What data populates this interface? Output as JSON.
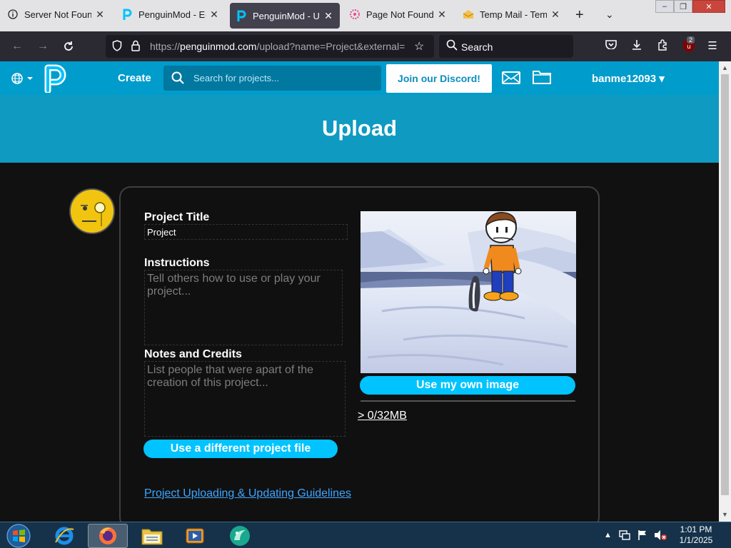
{
  "browser": {
    "tabs": [
      {
        "title": "Server Not Found",
        "icon": "info-icon",
        "active": false
      },
      {
        "title": "PenguinMod - Editor",
        "icon": "penguinmod-icon",
        "active": false
      },
      {
        "title": "PenguinMod - Upload",
        "icon": "penguinmod-icon",
        "active": true
      },
      {
        "title": "Page Not Found - ",
        "icon": "flower-icon",
        "active": false
      },
      {
        "title": "Temp Mail - Temporary",
        "icon": "mail-icon",
        "active": false
      }
    ],
    "url": {
      "prefix": "https://",
      "domain": "penguinmod.com",
      "path": "/upload?name=Project&external="
    },
    "search_label": "Search",
    "extension_badge": "2"
  },
  "site": {
    "create_label": "Create",
    "search_placeholder": "Search for projects...",
    "discord_label": "Join our Discord!",
    "username": "banme12093",
    "brand_color": "#009ccc"
  },
  "page": {
    "title": "Upload"
  },
  "form": {
    "project_title_label": "Project Title",
    "project_title_value": "Project",
    "instructions_label": "Instructions",
    "instructions_placeholder": "Tell others how to use or play your project...",
    "notes_label": "Notes and Credits",
    "notes_placeholder": "List people that were apart of the creation of this project...",
    "different_file_button": "Use a different project file",
    "own_image_button": "Use my own image",
    "size_text": "> 0/32MB",
    "guidelines_link": "Project Uploading & Updating Guidelines"
  },
  "taskbar": {
    "time": "1:01 PM",
    "date": "1/1/2025"
  }
}
